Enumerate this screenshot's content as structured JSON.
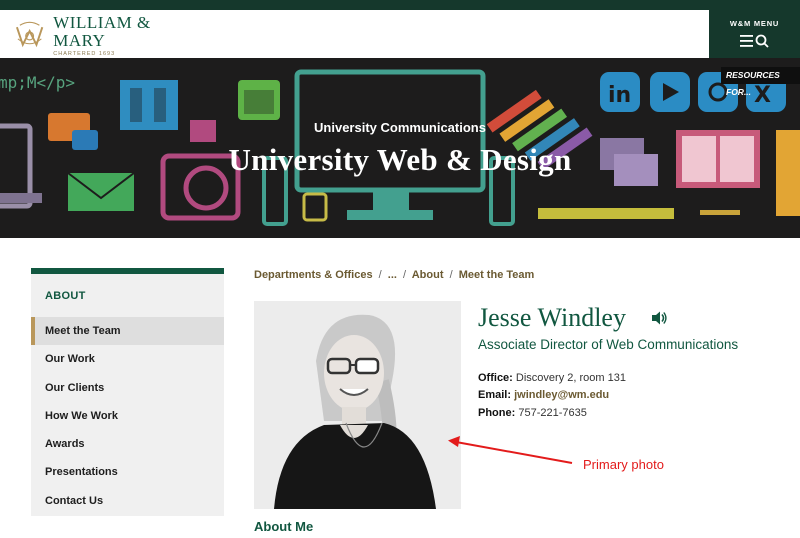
{
  "header": {
    "logo_name": "WILLIAM & MARY",
    "logo_tagline": "CHARTERED 1693",
    "menu_label": "W&M MENU"
  },
  "hero": {
    "code_text": "mp;M</p>",
    "kicker": "University Communications",
    "title": "University Web & Design",
    "resources_label": "RESOURCES FOR..."
  },
  "sidebar": {
    "heading": "ABOUT",
    "items": [
      {
        "label": "Meet the Team",
        "active": true
      },
      {
        "label": "Our Work"
      },
      {
        "label": "Our Clients"
      },
      {
        "label": "How We Work"
      },
      {
        "label": "Awards"
      },
      {
        "label": "Presentations"
      },
      {
        "label": "Contact Us"
      }
    ]
  },
  "breadcrumb": {
    "items": [
      "Departments & Offices",
      "...",
      "About",
      "Meet the Team"
    ],
    "separator": "/"
  },
  "profile": {
    "name": "Jesse Windley",
    "title": "Associate Director of Web Communications",
    "office_label": "Office:",
    "office_value": "Discovery 2, room 131",
    "email_label": "Email:",
    "email_value": "jwindley@wm.edu",
    "phone_label": "Phone:",
    "phone_value": "757-221-7635"
  },
  "annotation": {
    "label": "Primary photo",
    "color": "#e31b1b"
  },
  "section": {
    "about_me": "About Me"
  },
  "colors": {
    "brand_green": "#115740",
    "dark_green": "#15382c",
    "gold": "#b9975b"
  }
}
